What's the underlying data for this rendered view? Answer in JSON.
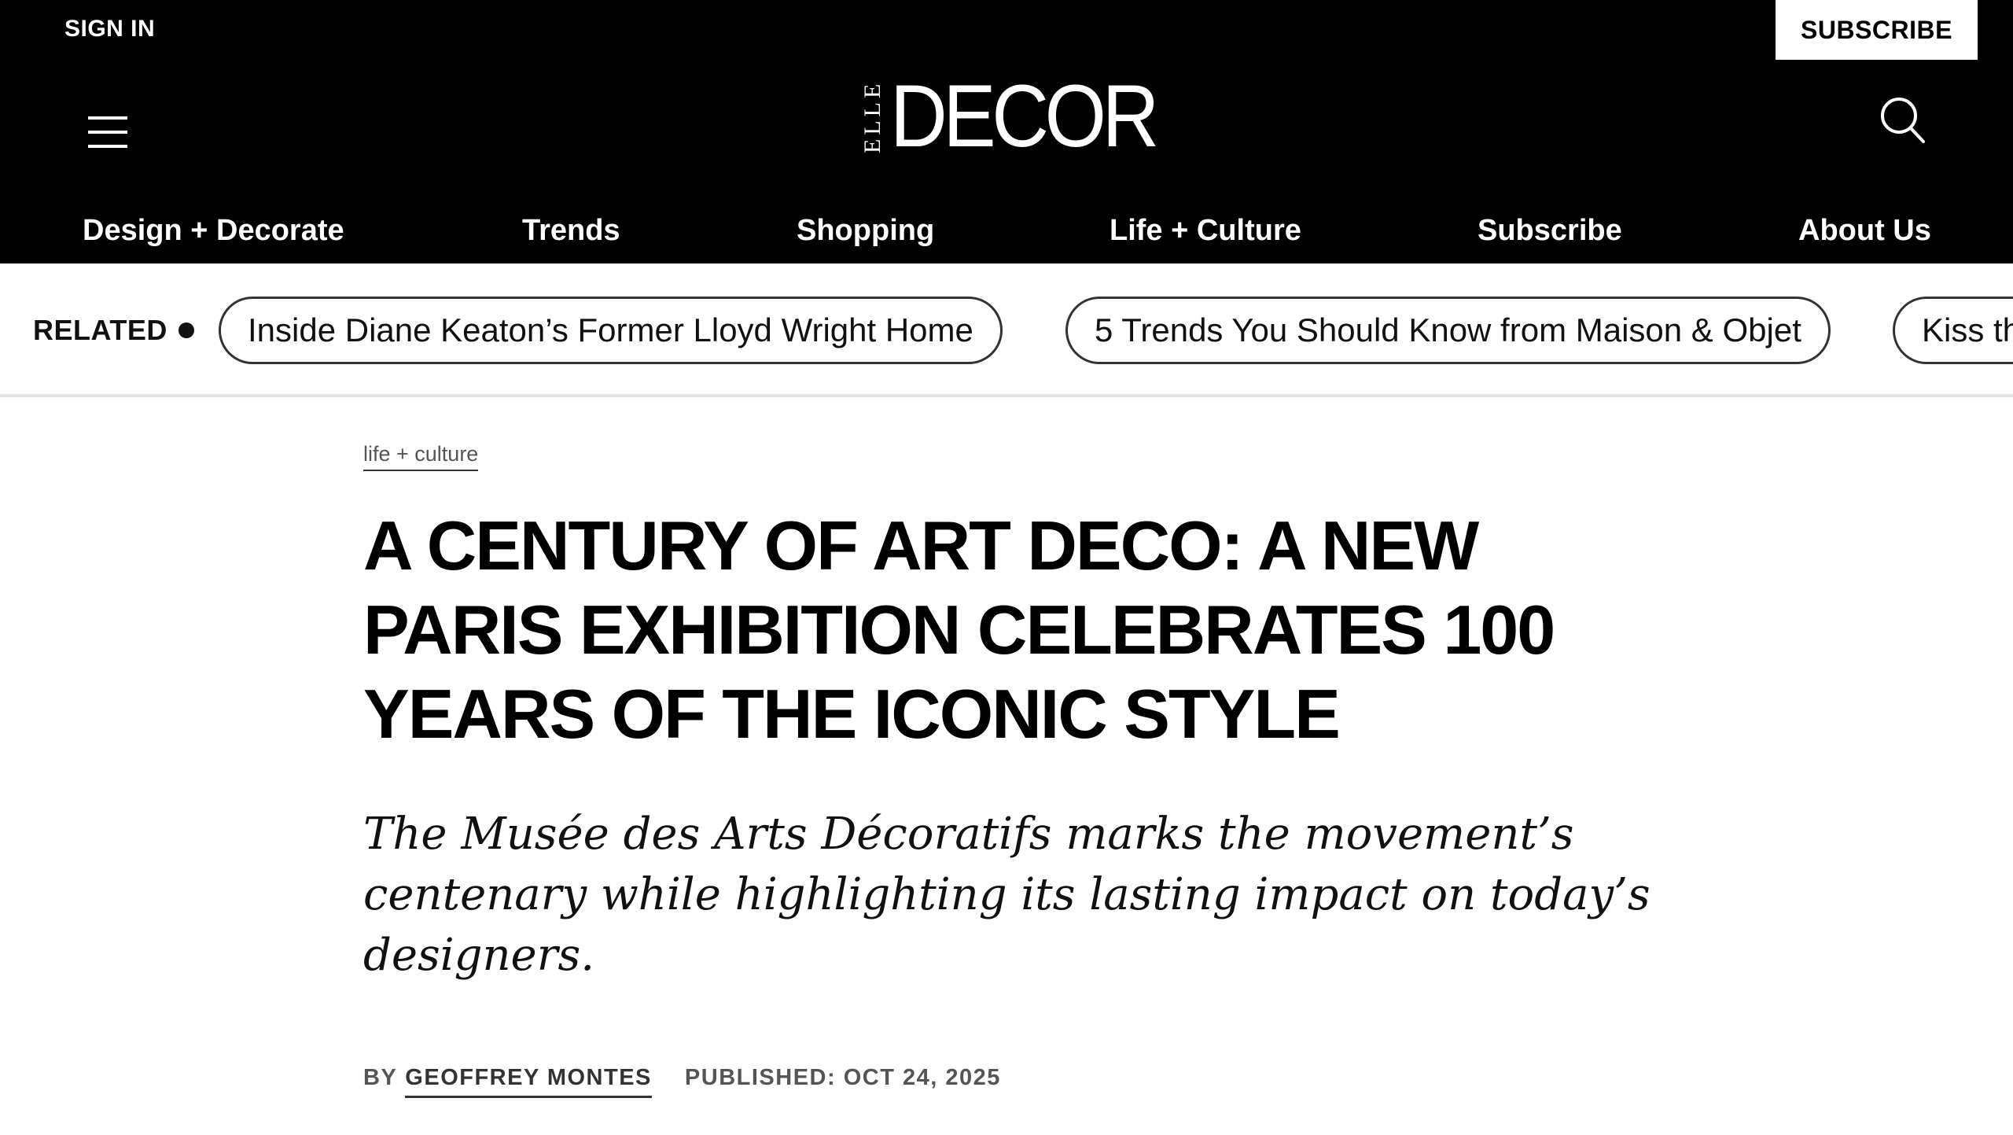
{
  "header": {
    "sign_in_label": "SIGN IN",
    "subscribe_label": "SUBSCRIBE",
    "logo": {
      "small": "ELLE",
      "large": "DECOR"
    },
    "icons": {
      "menu": "hamburger-menu-icon",
      "search": "search-icon"
    },
    "background": "#000000"
  },
  "nav": {
    "items": [
      {
        "label": "Design + Decorate"
      },
      {
        "label": "Trends"
      },
      {
        "label": "Shopping"
      },
      {
        "label": "Life + Culture"
      },
      {
        "label": "Subscribe"
      },
      {
        "label": "About Us"
      }
    ]
  },
  "related": {
    "label": "RELATED",
    "items": [
      {
        "label": "Inside Diane Keaton’s Former Lloyd Wright Home"
      },
      {
        "label": "5 Trends You Should Know from Maison & Objet"
      },
      {
        "label": "Kiss th"
      }
    ]
  },
  "article": {
    "category": "life + culture",
    "headline": "A CENTURY OF ART DECO: A NEW PARIS EXHIBITION CELEBRATES 100 YEARS OF THE ICONIC STYLE",
    "dek": "The Musée des Arts Décoratifs marks the movement’s centenary while highlighting its lasting impact on today’s designers.",
    "byline_prefix": "BY",
    "author": "GEOFFREY MONTES",
    "published": "PUBLISHED: OCT 24, 2025"
  },
  "colors": {
    "text": "#000000",
    "muted": "#555555",
    "divider": "#e3e3e3"
  }
}
